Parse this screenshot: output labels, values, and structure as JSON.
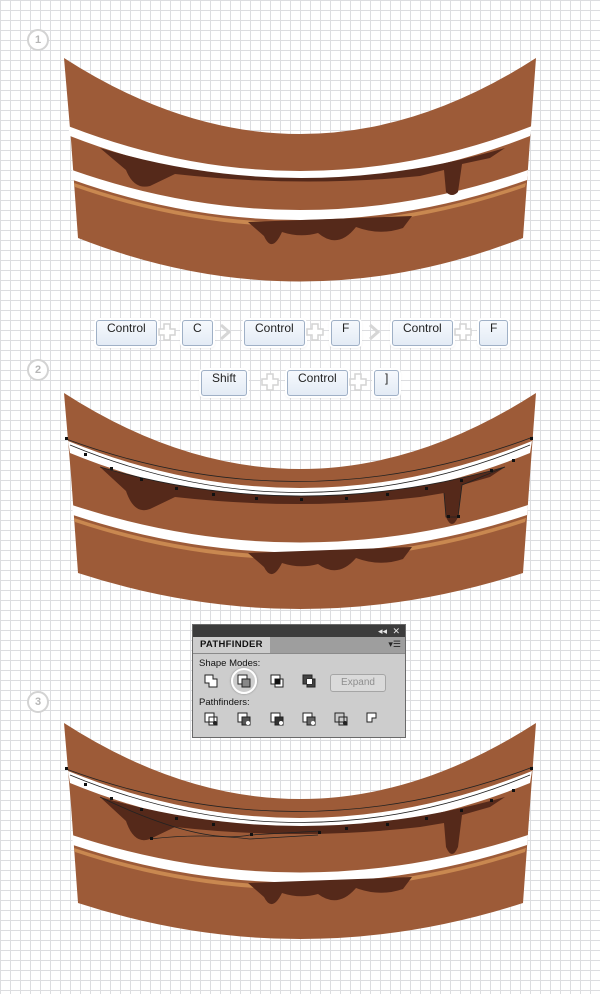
{
  "steps": [
    "1",
    "2",
    "3"
  ],
  "shortcut_row_1": [
    "Control",
    "C",
    "Control",
    "F",
    "Control",
    "F"
  ],
  "shortcut_row_2": [
    "Shift",
    "Control",
    "]"
  ],
  "pathfinder": {
    "tab_title": "PATHFINDER",
    "shape_modes_label": "Shape Modes:",
    "pathfinders_label": "Pathfinders:",
    "expand_label": "Expand",
    "collapse_icon": "double-arrow-left-icon",
    "close_icon": "close-icon",
    "menu_icon": "panel-menu-icon",
    "shape_mode_icons": [
      "unite-icon",
      "minus-front-icon",
      "intersect-icon",
      "exclude-icon"
    ],
    "pathfinder_icons": [
      "divide-icon",
      "trim-icon",
      "merge-icon",
      "crop-icon",
      "outline-icon",
      "minus-back-icon"
    ],
    "active_shape_mode": "minus-front-icon"
  },
  "colors": {
    "cake_brown": "#9d5b38",
    "cake_edge": "#b87849",
    "cream": "#ffffff",
    "chocolate": "#55291a",
    "key_border": "#9fb0c6",
    "grid_line": "#dcdde0"
  }
}
